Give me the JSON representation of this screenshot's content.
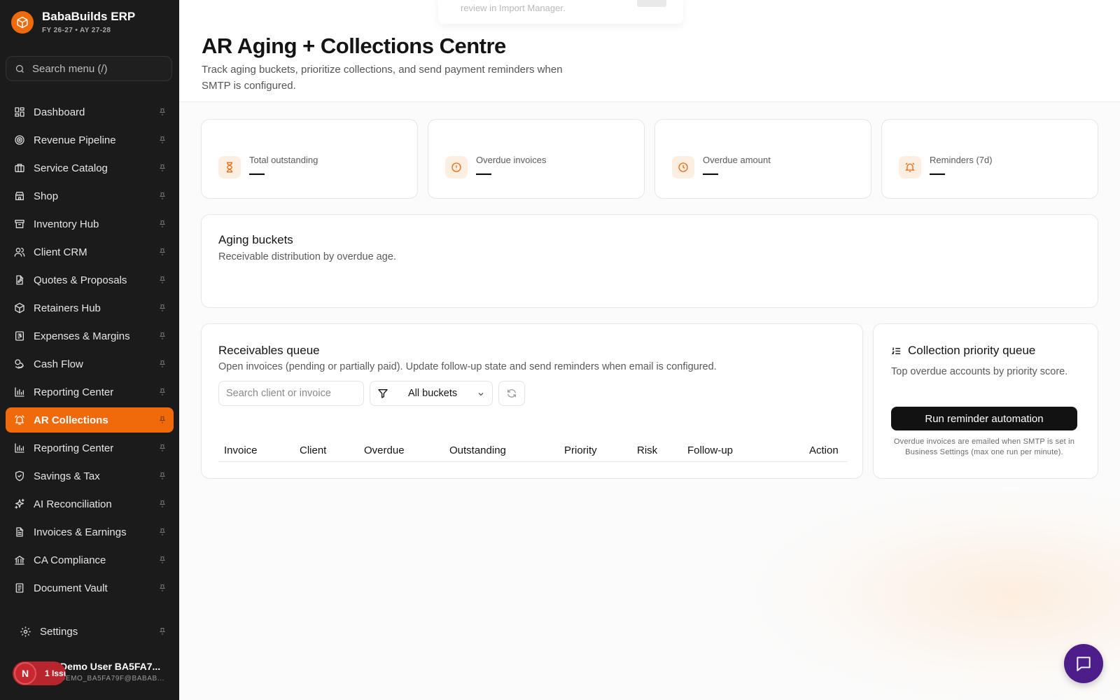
{
  "brand": {
    "name": "BabaBuilds ERP",
    "subtitle": "FY 26-27 • AY 27-28"
  },
  "sidebar": {
    "search_placeholder": "Search menu (/)",
    "items": [
      {
        "label": "Dashboard",
        "icon": "dashboard-icon"
      },
      {
        "label": "Revenue Pipeline",
        "icon": "target-icon"
      },
      {
        "label": "Service Catalog",
        "icon": "briefcase-icon"
      },
      {
        "label": "Shop",
        "icon": "store-icon"
      },
      {
        "label": "Inventory Hub",
        "icon": "archive-icon"
      },
      {
        "label": "Client CRM",
        "icon": "users-icon"
      },
      {
        "label": "Quotes & Proposals",
        "icon": "file-edit-icon"
      },
      {
        "label": "Retainers Hub",
        "icon": "package-icon"
      },
      {
        "label": "Expenses & Margins",
        "icon": "receipt-icon"
      },
      {
        "label": "Cash Flow",
        "icon": "coins-icon"
      },
      {
        "label": "Reporting Center",
        "icon": "bar-chart-icon"
      },
      {
        "label": "AR Collections",
        "icon": "alarm-icon",
        "active": true
      },
      {
        "label": "Reporting Center",
        "icon": "bar-chart-icon"
      },
      {
        "label": "Savings & Tax",
        "icon": "shield-icon"
      },
      {
        "label": "AI Reconciliation",
        "icon": "sparkles-icon"
      },
      {
        "label": "Invoices & Earnings",
        "icon": "file-text-icon"
      },
      {
        "label": "CA Compliance",
        "icon": "bank-icon"
      },
      {
        "label": "Document Vault",
        "icon": "document-icon"
      }
    ],
    "settings_label": "Settings",
    "user": {
      "name": "Demo User BA5FA7...",
      "email": "DEMO_BA5FA79F@BABAB...",
      "avatar_letter": "N",
      "issues": "1 Issue"
    }
  },
  "toast": {
    "text": "review in Import Manager."
  },
  "page": {
    "title": "AR Aging + Collections Centre",
    "description": "Track aging buckets, prioritize collections, and send payment reminders when SMTP is configured."
  },
  "kpis": [
    {
      "label": "Total outstanding",
      "value": "—",
      "icon": "hourglass-icon"
    },
    {
      "label": "Overdue invoices",
      "value": "—",
      "icon": "alert-circle-icon"
    },
    {
      "label": "Overdue amount",
      "value": "—",
      "icon": "clock-icon"
    },
    {
      "label": "Reminders (7d)",
      "value": "—",
      "icon": "bell-icon"
    }
  ],
  "aging": {
    "title": "Aging buckets",
    "subtitle": "Receivable distribution by overdue age."
  },
  "queue": {
    "title": "Receivables queue",
    "subtitle": "Open invoices (pending or partially paid). Update follow-up state and send reminders when email is configured.",
    "search_placeholder": "Search client or invoice",
    "bucket_value": "All buckets",
    "columns": [
      "Invoice",
      "Client",
      "Overdue",
      "Outstanding",
      "Priority",
      "Risk",
      "Follow-up",
      "Action"
    ]
  },
  "priority": {
    "title": "Collection priority queue",
    "subtitle": "Top overdue accounts by priority score.",
    "button": "Run reminder automation",
    "note": "Overdue invoices are emailed when SMTP is set in Business Settings (max one run per minute)."
  },
  "colors": {
    "accent": "#f06a0c",
    "sidebar_bg": "#1b1b1b",
    "chat": "#4d1d8a"
  }
}
